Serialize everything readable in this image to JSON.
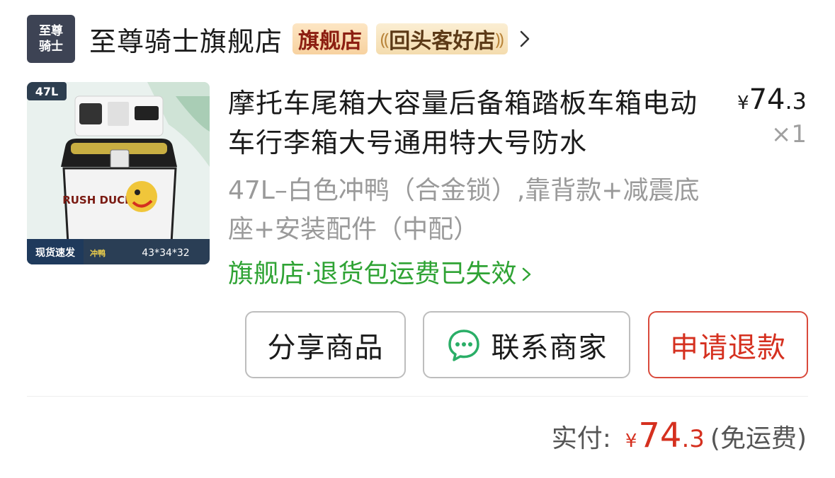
{
  "store": {
    "logo_text": "至尊\n骑士",
    "name": "至尊骑士旗舰店",
    "badge_flagship": "旗舰店",
    "badge_repeat": "回头客好店"
  },
  "product": {
    "image": {
      "size_tag": "47L",
      "brand_text": "RUSH DUCK",
      "bottom_left": "现货速发",
      "bottom_mid": "冲鸭",
      "dimensions": "43*34*32"
    },
    "title": "摩托车尾箱大容量后备箱踏板车箱电动车行李箱大号通用特大号防水",
    "variant": "47L–白色冲鸭（合金锁）,靠背款+减震底座+安装配件（中配）",
    "return_note": "旗舰店·退货包运费已失效",
    "price": {
      "currency": "¥",
      "integer": "74",
      "decimal": ".3"
    },
    "quantity": "×1"
  },
  "actions": {
    "share_label": "分享商品",
    "contact_label": "联系商家",
    "refund_label": "申请退款"
  },
  "payment": {
    "label": "实付:",
    "currency": "¥",
    "integer": "74",
    "decimal": ".3",
    "shipping_note": "(免运费)"
  },
  "colors": {
    "accent_red": "#d5301f",
    "green": "#2fa334",
    "wechat_green": "#2aae67"
  }
}
